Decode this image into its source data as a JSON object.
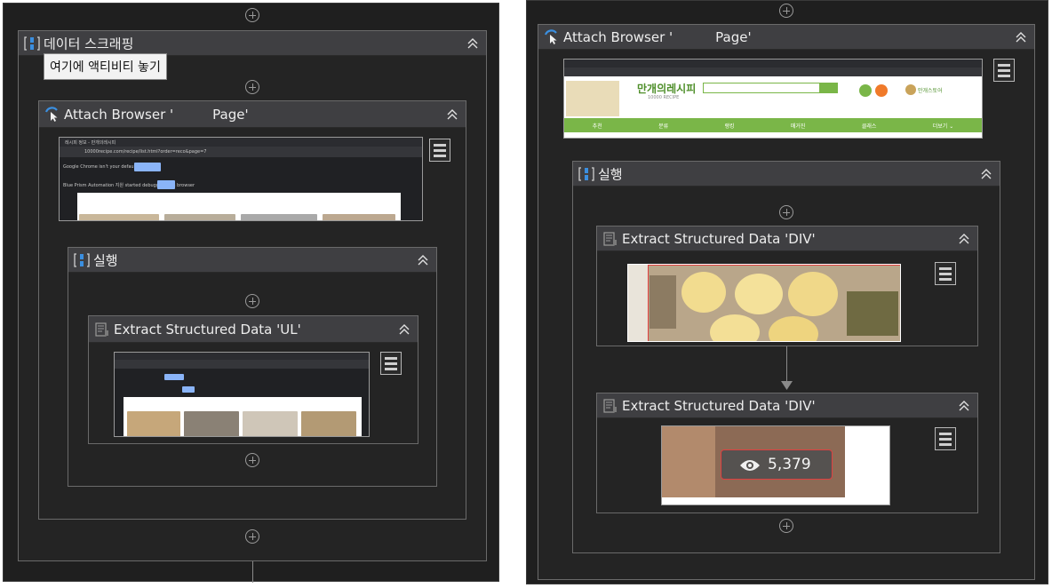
{
  "left": {
    "outer_block": {
      "title": "데이터 스크래핑",
      "tooltip": "여기에 액티비티 놓기"
    },
    "attach": {
      "title": "Attach Browser '",
      "title_suffix": "Page'"
    },
    "execute": {
      "title": "실행"
    },
    "extract": {
      "title": "Extract Structured Data 'UL'"
    },
    "browser_shot": {
      "tab": "레시피 정보 - 만개의레시피",
      "url": "10000recipe.com/recipe/list.html?order=reco&page=7",
      "bar1": "Google Chrome isn't your default browser",
      "bar1_button": "Set as default",
      "bar2": "Blue Prism Automation 지원 started debugging this browser",
      "bar2_button": "Cancel"
    }
  },
  "right": {
    "attach": {
      "title": "Attach Browser '",
      "title_suffix": "Page'"
    },
    "execute": {
      "title": "실행"
    },
    "extract1": {
      "title": "Extract Structured Data 'DIV'"
    },
    "extract2": {
      "title": "Extract Structured Data 'DIV'",
      "view_count": "5,379"
    },
    "site": {
      "logo": "만개의레시피",
      "logo_sub": "10000 RECIPE",
      "store": "만개스토어",
      "nav": [
        "추천",
        "분류",
        "랭킹",
        "매거진",
        "클래스",
        "더보기 ⌄"
      ]
    }
  },
  "colors": {
    "bg": "#1f1f1f",
    "header": "#3f3f42",
    "accent_blue": "#3b8fe0",
    "site_green": "#7ab648",
    "highlight": "#e04040"
  }
}
